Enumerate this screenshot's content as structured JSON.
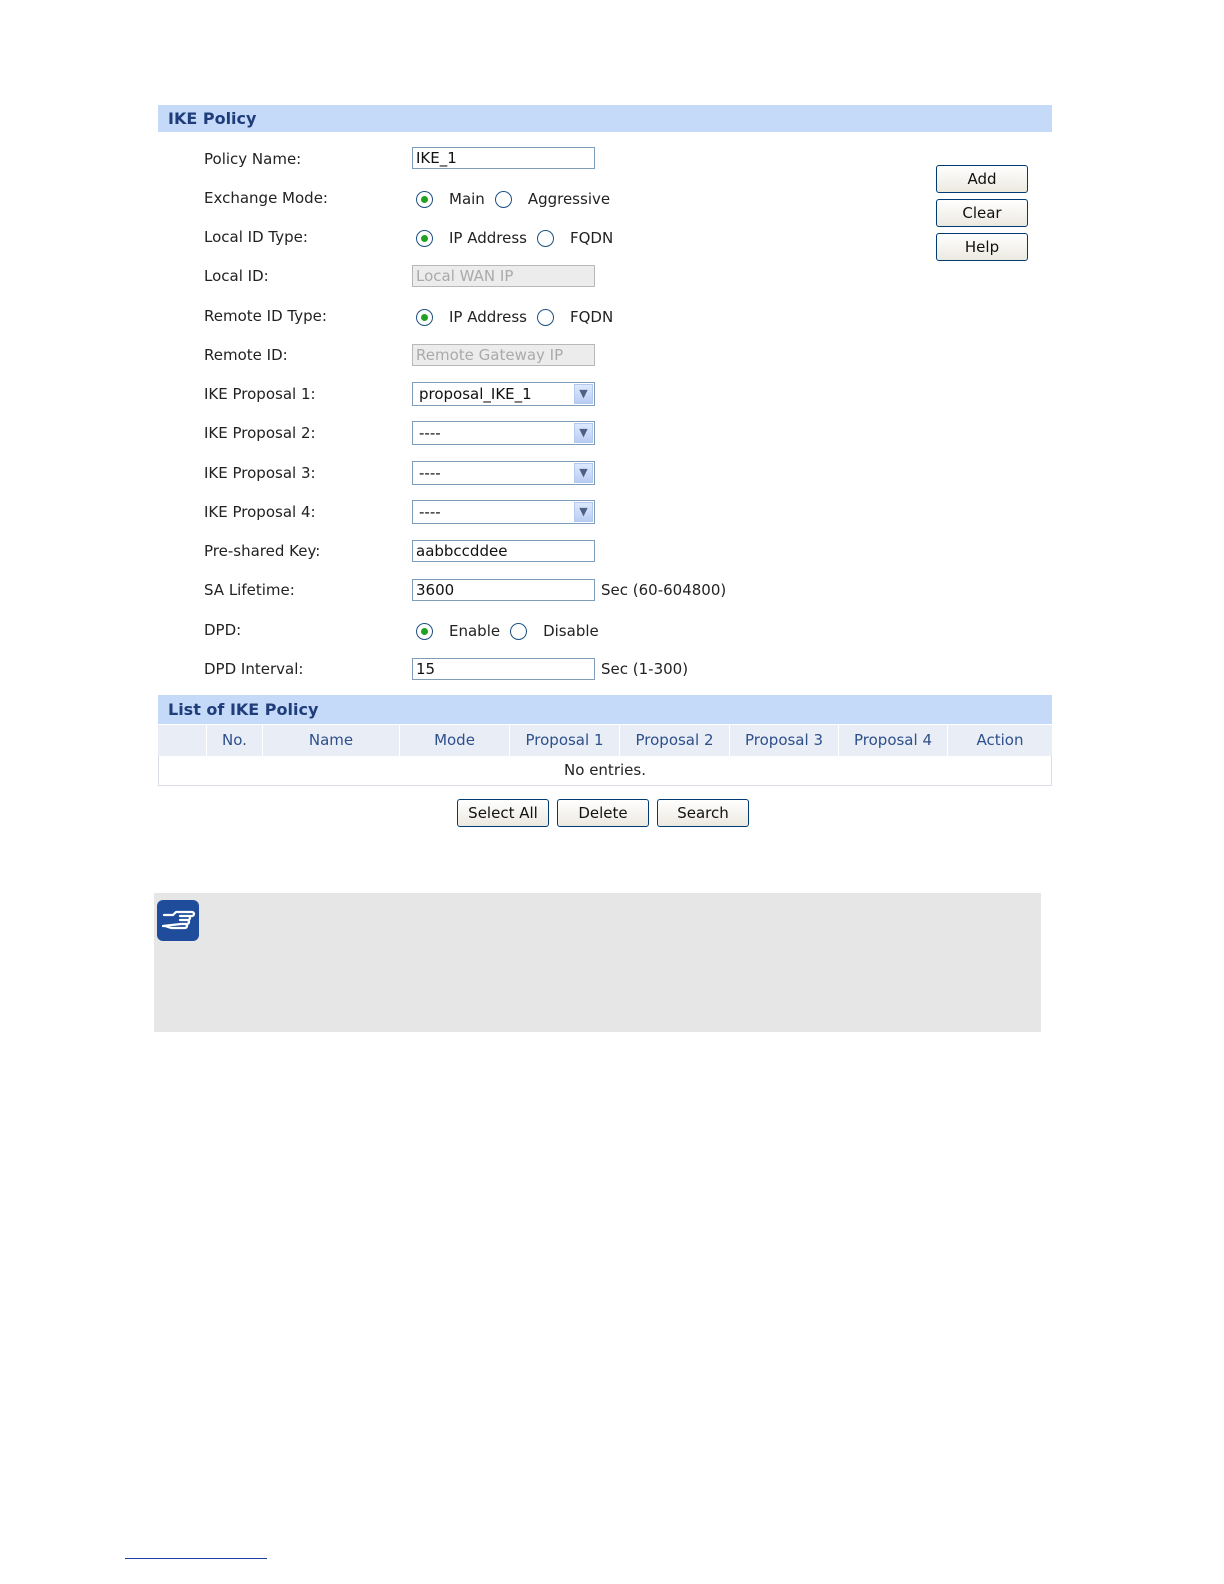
{
  "ike_policy": {
    "title": "IKE Policy",
    "policy_name": {
      "label": "Policy Name:",
      "value": "IKE_1"
    },
    "exchange_mode": {
      "label": "Exchange Mode:",
      "options": [
        "Main",
        "Aggressive"
      ],
      "selected": "Main"
    },
    "local_id_type": {
      "label": "Local ID Type:",
      "options": [
        "IP Address",
        "FQDN"
      ],
      "selected": "IP Address"
    },
    "local_id": {
      "label": "Local ID:",
      "placeholder": "Local WAN IP"
    },
    "remote_id_type": {
      "label": "Remote ID Type:",
      "options": [
        "IP Address",
        "FQDN"
      ],
      "selected": "IP Address"
    },
    "remote_id": {
      "label": "Remote ID:",
      "placeholder": "Remote Gateway IP"
    },
    "proposals": [
      {
        "label": "IKE Proposal 1:",
        "value": "proposal_IKE_1"
      },
      {
        "label": "IKE Proposal 2:",
        "value": "----"
      },
      {
        "label": "IKE Proposal 3:",
        "value": "----"
      },
      {
        "label": "IKE Proposal 4:",
        "value": "----"
      }
    ],
    "preshared_key": {
      "label": "Pre-shared Key:",
      "value": "aabbccddee"
    },
    "sa_lifetime": {
      "label": "SA Lifetime:",
      "value": "3600",
      "suffix": "Sec (60-604800)"
    },
    "dpd": {
      "label": "DPD:",
      "options": [
        "Enable",
        "Disable"
      ],
      "selected": "Enable"
    },
    "dpd_interval": {
      "label": "DPD Interval:",
      "value": "15",
      "suffix": "Sec (1-300)"
    },
    "buttons": {
      "add": "Add",
      "clear": "Clear",
      "help": "Help"
    }
  },
  "list": {
    "title": "List of IKE Policy",
    "columns": [
      "No.",
      "Name",
      "Mode",
      "Proposal 1",
      "Proposal 2",
      "Proposal 3",
      "Proposal 4",
      "Action"
    ],
    "empty_text": "No entries.",
    "buttons": {
      "select_all": "Select All",
      "delete": "Delete",
      "search": "Search"
    }
  },
  "colors": {
    "section_bar": "#c5d9f8",
    "header_text": "#1f3d7a",
    "note_bg": "#e6e6e6",
    "note_icon": "#1f4d9b"
  },
  "icons": {
    "note": "pointing-hand-icon"
  }
}
